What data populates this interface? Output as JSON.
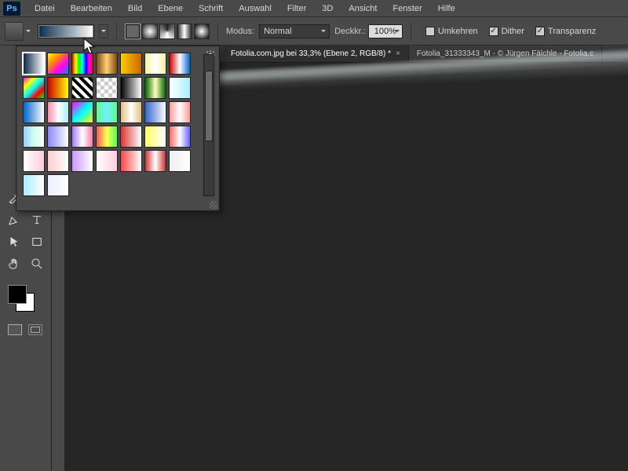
{
  "app": {
    "logo": "Ps"
  },
  "menu": [
    "Datei",
    "Bearbeiten",
    "Bild",
    "Ebene",
    "Schrift",
    "Auswahl",
    "Filter",
    "3D",
    "Ansicht",
    "Fenster",
    "Hilfe"
  ],
  "options": {
    "mode_label": "Modus:",
    "mode_value": "Normal",
    "opacity_label": "Deckkr.:",
    "opacity_value": "100%",
    "reverse_label": "Umkehren",
    "reverse_checked": false,
    "dither_label": "Dither",
    "dither_checked": true,
    "transparency_label": "Transparenz",
    "transparency_checked": true
  },
  "tabs": [
    {
      "label": "Fotolia.com.jpg bei 33,3% (Ebene 2, RGB/8) *",
      "active": true
    },
    {
      "label": "Fotolia_31333343_M - © Jürgen Fälchle - Fotolia.c",
      "active": false
    }
  ],
  "gradient_picker": {
    "rows": 6,
    "cols": 7,
    "total_slots": 37,
    "selected_index": 0,
    "swatches": [
      "linear-gradient(90deg,#0b2a4a,#fff)",
      "linear-gradient(135deg,#ff0,#f80,#f0f,#08f)",
      "linear-gradient(90deg,#f00,#ff0,#0f0,#0ff,#00f,#f0f,#f00)",
      "linear-gradient(90deg,#7a4a1a,#ffcf70,#7a4a1a)",
      "linear-gradient(90deg,#fc0,#c60)",
      "linear-gradient(90deg,#f5f5a0,#fff,#f5f5a0)",
      "linear-gradient(90deg,#c00,#fff,#06c)",
      "linear-gradient(135deg,#f0f,#ff0,#0ff,#f00,#0f0)",
      "linear-gradient(90deg,#c00,#ff0)",
      "repeating-linear-gradient(45deg,#000 0 4px,#fff 4px 8px)",
      "repeating-conic-gradient(#ccc 0 25%,#fff 0 50%)",
      "linear-gradient(90deg,#000,#fff)",
      "linear-gradient(90deg,#060,#ffb,#060)",
      "linear-gradient(90deg,#fff,#aef)",
      "linear-gradient(90deg,#06c,#fff)",
      "linear-gradient(90deg,#f8a,#fff,#aef)",
      "linear-gradient(135deg,#f0f,#0ff,#ff0)",
      "linear-gradient(90deg,#5f8,#7ef,#5f8)",
      "linear-gradient(90deg,#e0c080,#fff,#e0c080)",
      "linear-gradient(90deg,#36c,#fff)",
      "linear-gradient(90deg,#f99,#fff,#f99)",
      "linear-gradient(90deg,#9cf,#cfe,#fff)",
      "linear-gradient(90deg,#88f,#fff)",
      "linear-gradient(90deg,#a7f,#fff,#f7a)",
      "linear-gradient(90deg,#f55,#ff5,#5f5)",
      "linear-gradient(90deg,#d33,#fff)",
      "linear-gradient(90deg,#ff6,#fff)",
      "linear-gradient(90deg,#f66,#fff,#66f)",
      "linear-gradient(90deg,#fff,#fcd)",
      "linear-gradient(90deg,#fcc,#fff)",
      "linear-gradient(90deg,#c9f,#fff)",
      "linear-gradient(90deg,#fff,#fcd)",
      "linear-gradient(90deg,#f44,#fff)",
      "linear-gradient(90deg,#c33,#fff,#c33)",
      "linear-gradient(90deg,#eee,#fff)",
      "linear-gradient(90deg,#aef,#fff)",
      "linear-gradient(90deg,#eef,#fff)"
    ]
  },
  "tools": {
    "row1": [
      "eyedropper-tool",
      "healing-brush-tool"
    ],
    "row2": [
      "brush-tool",
      "clone-stamp-tool"
    ],
    "row3": [
      "gradient-tool",
      "dodge-tool"
    ],
    "row4": [
      "pen-tool",
      "type-tool"
    ],
    "row5": [
      "path-select-tool",
      "rectangle-tool"
    ],
    "row6": [
      "hand-tool",
      "zoom-tool"
    ]
  },
  "colors": {
    "foreground": "#000000",
    "background": "#ffffff"
  }
}
